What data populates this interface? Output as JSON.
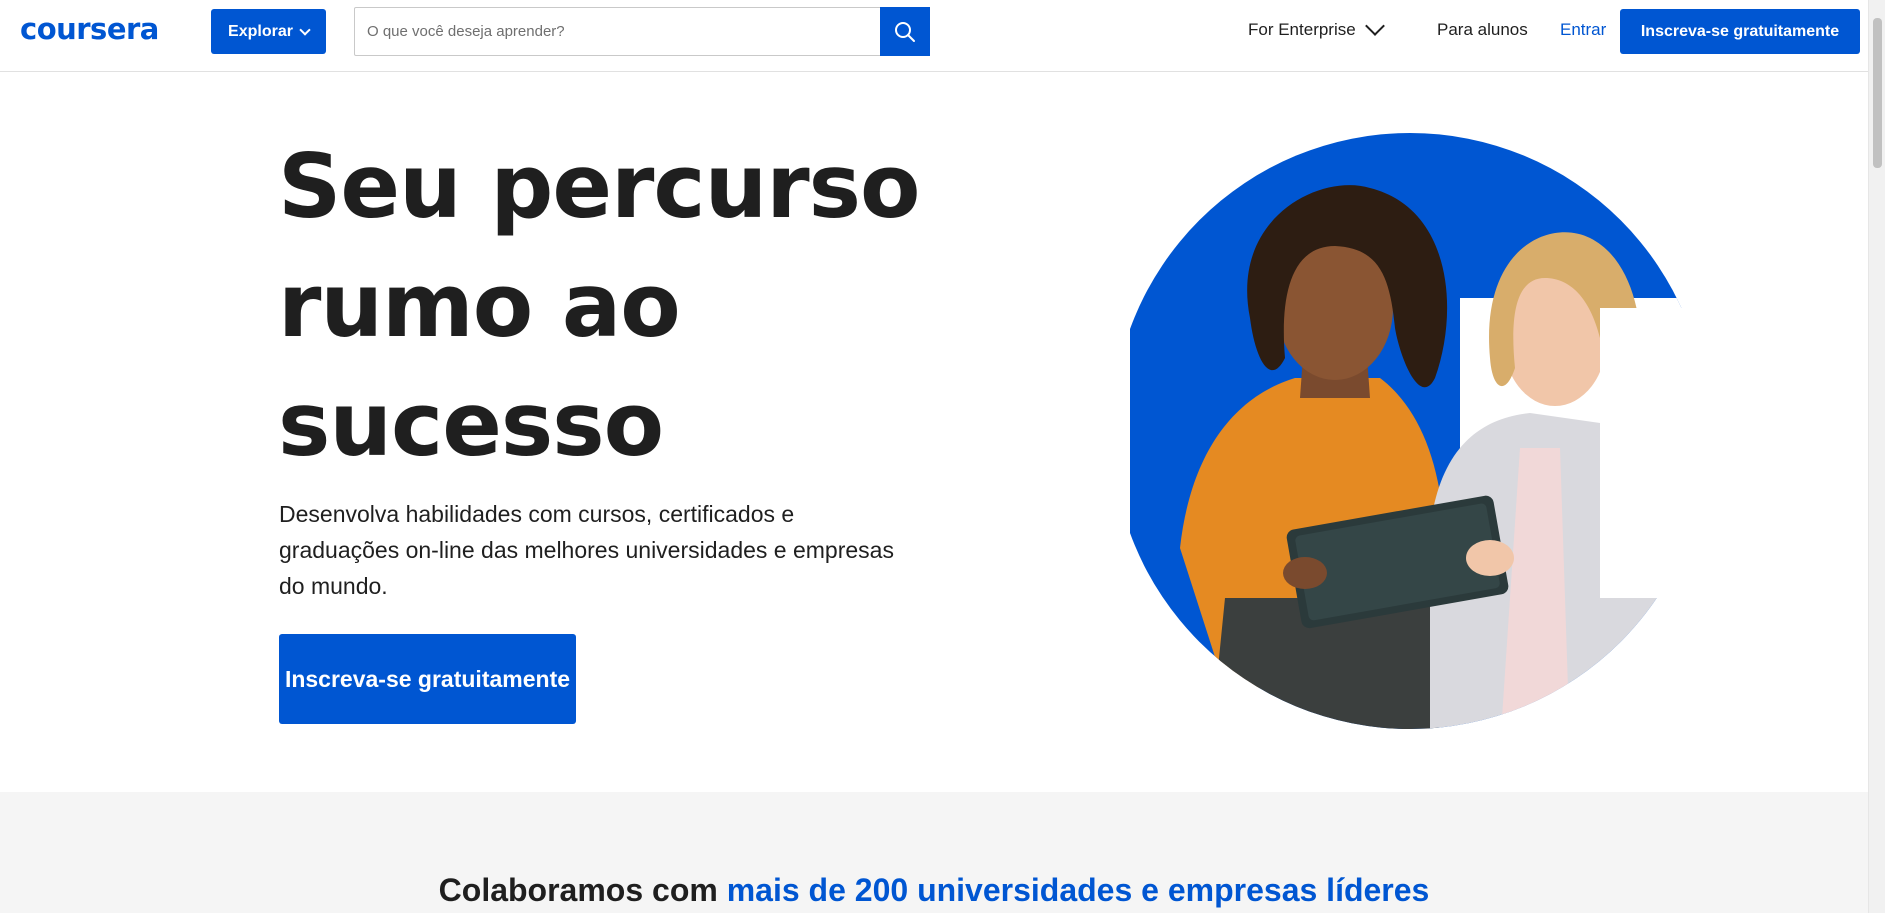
{
  "header": {
    "logo": "coursera",
    "explore_label": "Explorar",
    "search_placeholder": "O que você deseja aprender?",
    "enterprise_label": "For Enterprise",
    "students_label": "Para alunos",
    "login_label": "Entrar",
    "signup_label": "Inscreva-se gratuitamente"
  },
  "hero": {
    "title": "Seu percurso rumo ao sucesso",
    "description": "Desenvolva habilidades com cursos, certificados e graduações on-line das melhores universidades e empresas do mundo.",
    "cta_label": "Inscreva-se gratuitamente"
  },
  "partners": {
    "prefix": "Colaboramos com ",
    "highlight": "mais de 200 universidades e empresas líderes"
  },
  "colors": {
    "brand": "#0056d2",
    "text": "#1f1f1f",
    "band_bg": "#f5f5f5"
  },
  "icons": [
    "search-icon",
    "chevron-down-icon"
  ]
}
